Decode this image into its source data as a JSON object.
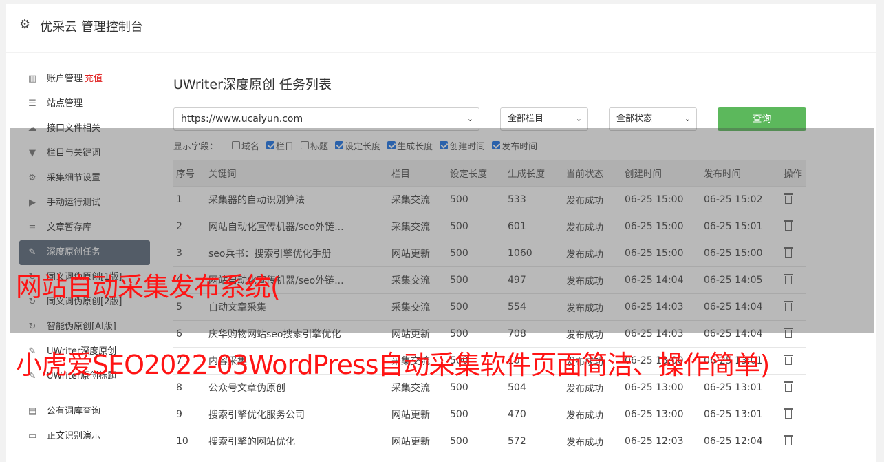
{
  "header": {
    "title": "优采云 管理控制台",
    "icon": "gear-icon"
  },
  "sidebar": {
    "items": [
      {
        "label": "账户管理",
        "badge": "充值",
        "icon": "bar-chart-icon",
        "glyph": "▥"
      },
      {
        "label": "站点管理",
        "icon": "server-icon",
        "glyph": "☰"
      },
      {
        "label": "接口文件相关",
        "icon": "cloud-upload-icon",
        "glyph": "☁"
      },
      {
        "label": "栏目与关键词",
        "icon": "filter-icon",
        "glyph": "▼"
      },
      {
        "label": "采集细节设置",
        "icon": "cogs-icon",
        "glyph": "⚙"
      },
      {
        "label": "手动运行测试",
        "icon": "play-circle-icon",
        "glyph": "▶"
      },
      {
        "label": "文章暂存库",
        "icon": "database-icon",
        "glyph": "≡"
      },
      {
        "label": "深度原创任务",
        "icon": "edit-icon",
        "glyph": "✎",
        "active": true
      },
      {
        "label": "同义词伪原创[1版]",
        "icon": "refresh-icon",
        "glyph": "↻"
      },
      {
        "label": "同义词伪原创[2版]",
        "icon": "refresh-icon",
        "glyph": "↻"
      },
      {
        "label": "智能伪原创[AI版]",
        "icon": "refresh-icon",
        "glyph": "↻"
      },
      {
        "label": "UWriter深度原创",
        "icon": "edit-icon",
        "glyph": "✎"
      },
      {
        "label": "UWriter原创标题",
        "icon": "edit-icon",
        "glyph": "✎"
      }
    ],
    "items2": [
      {
        "label": "公有词库查询",
        "icon": "book-icon",
        "glyph": "▤"
      },
      {
        "label": "正文识别演示",
        "icon": "monitor-icon",
        "glyph": "▭"
      }
    ]
  },
  "main": {
    "title": "UWriter深度原创 任务列表",
    "url_select": "https://www.ucaiyun.com",
    "column_select": "全部栏目",
    "status_select": "全部状态",
    "query_button": "查询",
    "fields_label": "显示字段：",
    "fields": [
      {
        "label": "域名",
        "checked": false
      },
      {
        "label": "栏目",
        "checked": true
      },
      {
        "label": "标题",
        "checked": false
      },
      {
        "label": "设定长度",
        "checked": true
      },
      {
        "label": "生成长度",
        "checked": true
      },
      {
        "label": "创建时间",
        "checked": true
      },
      {
        "label": "发布时间",
        "checked": true
      }
    ],
    "columns": [
      "序号",
      "关键词",
      "栏目",
      "设定长度",
      "生成长度",
      "当前状态",
      "创建时间",
      "发布时间",
      "操作"
    ],
    "rows": [
      [
        "1",
        "采集器的自动识别算法",
        "采集交流",
        "500",
        "533",
        "发布成功",
        "06-25 15:00",
        "06-25 15:02"
      ],
      [
        "2",
        "网站自动化宣传机器/seo外链...",
        "采集交流",
        "500",
        "601",
        "发布成功",
        "06-25 15:00",
        "06-25 15:01"
      ],
      [
        "3",
        "seo兵书：搜索引擎优化手册",
        "网站更新",
        "500",
        "1060",
        "发布成功",
        "06-25 15:00",
        "06-25 15:00"
      ],
      [
        "4",
        "网站自动化宣传机器/seo外链...",
        "采集交流",
        "500",
        "497",
        "发布成功",
        "06-25 14:04",
        "06-25 14:05"
      ],
      [
        "5",
        "自动文章采集",
        "采集交流",
        "500",
        "554",
        "发布成功",
        "06-25 14:03",
        "06-25 14:04"
      ],
      [
        "6",
        "庆华购物网站seo搜索引擎优化",
        "网站更新",
        "500",
        "708",
        "发布成功",
        "06-25 14:03",
        "06-25 14:04"
      ],
      [
        "7",
        "内容采集",
        "采集交流",
        "500",
        "10",
        "发布成功",
        "06-25 13:00",
        "06-25 13:01"
      ],
      [
        "8",
        "公众号文章伪原创",
        "采集交流",
        "500",
        "504",
        "发布成功",
        "06-25 13:00",
        "06-25 13:01"
      ],
      [
        "9",
        "搜索引擎优化服务公司",
        "网站更新",
        "500",
        "470",
        "发布成功",
        "06-25 13:00",
        "06-25 13:01"
      ],
      [
        "10",
        "搜索引擎的网站优化",
        "网站更新",
        "500",
        "572",
        "发布成功",
        "06-25 12:03",
        "06-25 12:04"
      ]
    ]
  },
  "overlay": {
    "line1": "网站自动采集发布系统(",
    "line2": "小虎爱SEO2022-03WordPress自动采集软件页面简洁、操作简单)"
  },
  "colors": {
    "accent": "#5cb85c",
    "active_menu": "#5b6a7b",
    "status_ok": "#2e8b2e",
    "overlay_text": "#ff1414",
    "recharge": "#e02020"
  }
}
